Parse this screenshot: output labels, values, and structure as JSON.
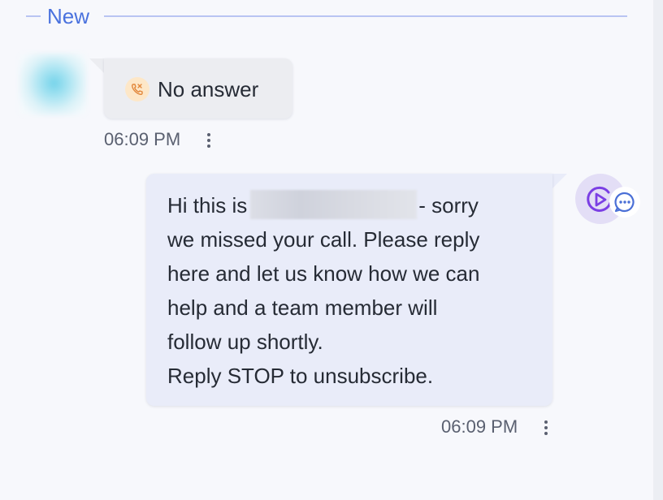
{
  "divider": {
    "label": "New"
  },
  "incoming": {
    "text": "No answer",
    "time": "06:09 PM",
    "icon": "missed-call-icon",
    "icon_color": "#e2873b"
  },
  "outgoing": {
    "line1_start": "Hi this is",
    "line1_end": "- sorry",
    "lines": [
      "we missed your call. Please reply",
      "here and let us know how we can",
      "help and a team member will",
      "follow up shortly.",
      "Reply STOP to unsubscribe."
    ],
    "time": "06:09 PM",
    "agent_icon": "play-circle-icon",
    "badge_icon": "chat-bubble-icon"
  },
  "colors": {
    "accent": "#4a72de",
    "agent": "#7b3fe4",
    "badge": "#4a6fd6"
  }
}
